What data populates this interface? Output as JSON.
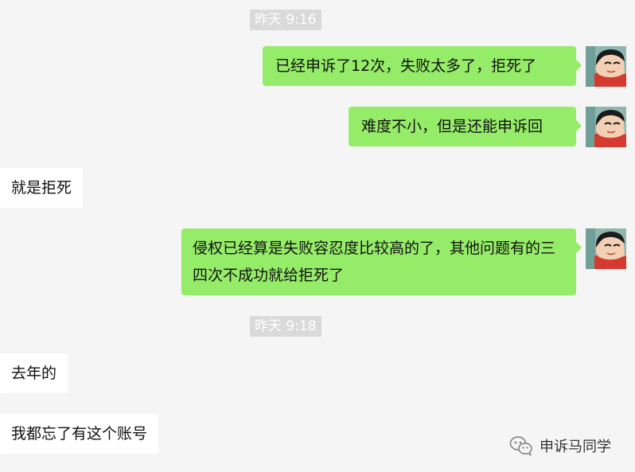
{
  "timestamps": [
    {
      "text": "昨天 9:16"
    },
    {
      "text": "昨天 9:18"
    }
  ],
  "messages": [
    {
      "side": "right",
      "text": "已经申诉了12次，失败太多了，拒死了"
    },
    {
      "side": "right",
      "text": "难度不小，但是还能申诉回"
    },
    {
      "side": "left",
      "text": "就是拒死"
    },
    {
      "side": "right",
      "text": "侵权已经算是失败容忍度比较高的了，其他问题有的三四次不成功就给拒死了"
    },
    {
      "side": "left",
      "text": "去年的"
    },
    {
      "side": "left",
      "text": "我都忘了有这个账号"
    }
  ],
  "watermark": {
    "text": "申诉马同学",
    "icon": "wechat-official-account-icon"
  },
  "colors": {
    "background": "#f5f5f5",
    "sent_bubble": "#95ec69",
    "received_bubble": "#ffffff",
    "timestamp_bg": "#dadada",
    "timestamp_text": "#ffffff"
  }
}
